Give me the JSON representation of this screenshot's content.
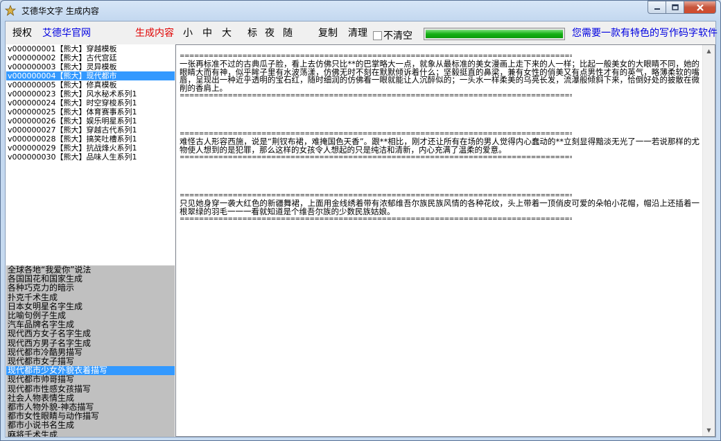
{
  "window": {
    "title": "艾德华文字 生成内容",
    "controls": {
      "minimize": "‒",
      "maximize": "□",
      "close": "✕"
    }
  },
  "toolbar": {
    "authorize": "授权",
    "official_site": "艾德华官网",
    "generate": "生成内容",
    "font_small": "小",
    "font_medium": "中",
    "font_large": "大",
    "style_standard": "标",
    "style_night": "夜",
    "style_random": "随",
    "copy": "复制",
    "clear": "清理",
    "no_clear_label": "不清空",
    "no_clear_checked": false,
    "progress_value": 1.0,
    "ad_text": "您需要一款有特色的写作码字软件"
  },
  "template_list": {
    "selected_index": 3,
    "items": [
      "v000000001【熊大】穿越模板",
      "v000000002【熊大】古代宫廷",
      "v000000003【熊大】灵异模板",
      "v000000004【熊大】现代都市",
      "v000000005【熊大】修真模板",
      "v000000023【熊大】风水秘术系列1",
      "v000000024【熊大】时空穿梭系列1",
      "v000000025【熊大】体育赛事系列1",
      "v000000026【熊大】娱乐明星系列1",
      "v000000027【熊大】穿越古代系列1",
      "v000000028【熊大】搞笑吐槽系列1",
      "v000000029【熊大】抗战烽火系列1",
      "v000000030【熊大】品味人生系列1"
    ]
  },
  "category_list": {
    "selected_index": 11,
    "items": [
      "全球各地“我爱你”说法",
      "各国国花和国家生成",
      "各种巧克力的暗示",
      "扑克千术生成",
      "日本女明星名字生成",
      "比喻句例子生成",
      "汽车品牌名字生成",
      "现代西方女子名字生成",
      "现代西方男子名字生成",
      "现代都市冷酷男描写",
      "现代都市女子描写",
      "现代都市少女外貌衣着描写",
      "现代都市帅哥描写",
      "现代都市性感女孩描写",
      "社会人物表情生成",
      "都市人物外貌-神态描写",
      "都市女性眼睛与动作描写",
      "都市小说书名生成",
      "麻将千术生成"
    ]
  },
  "content": {
    "separator": "==========================================================================================",
    "paragraphs": [
      "一张再标准不过的古典瓜子脸，看上去仿佛只比**的巴掌略大一点，就象从最标准的美女漫画上走下来的人一样；比起一般美女的大眼睛不同，她的眼睛大而有神，似乎眸子里有水波荡漾，仿佛无时不刻在默默倾诉着什么；坚毅挺直的鼻梁，兼有女性的俏美又有点男性才有的英气，略薄柔软的嘴唇，呈现出一种近乎透明的宝石红，随时细润的仿佛看一眼就能让人沉醉似的；一头水一样柔美的乌亮长发，流瀑般倾斜下来，恰倒好处的披散在微削的香肩上。",
      "难怪古人形容西施，说是“荆钗布裙，难掩国色天香”。跟**相比，刚才还让所有在场的男人觉得内心蠢动的**立刻显得黯淡无光了一一若说那样的尤物使人想到的是犯罪，那么这样的女孩令人想起的只是纯洁和清新，内心充满了温柔的爱意。",
      "只见她身穿一袭大红色的新疆舞裙，上面用金线绣着带有浓郁维吾尔族民族风情的各种花纹，头上带着一顶俏皮可爱的朵帕小花帽，帽沿上还插着一根翠绿的羽毛一一一看就知道是个维吾尔族的少数民族姑娘。"
    ]
  }
}
